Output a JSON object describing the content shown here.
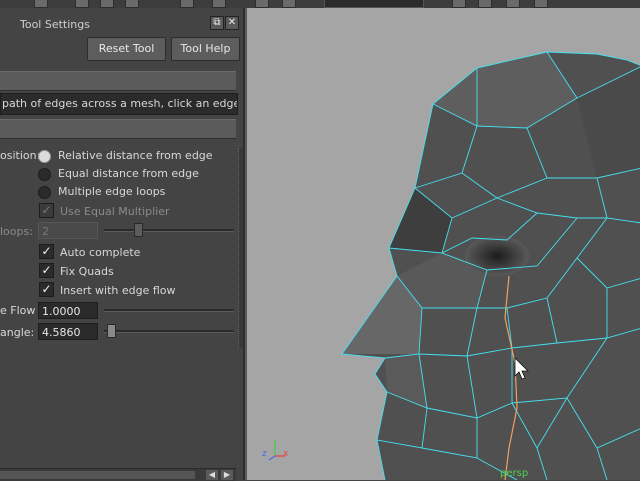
{
  "panel": {
    "title": "Tool Settings",
    "float_glyph": "⧉",
    "close_glyph": "✕",
    "buttons": {
      "reset": "Reset Tool",
      "help": "Tool Help"
    },
    "description": "path of edges across a mesh, click an edge and d",
    "insert_position": {
      "label": "osition:",
      "options": [
        {
          "label": "Relative distance from edge",
          "selected": true
        },
        {
          "label": "Equal distance from edge",
          "selected": false
        },
        {
          "label": "Multiple edge loops",
          "selected": false
        }
      ]
    },
    "use_equal_multiplier": {
      "label": "Use Equal Multiplier",
      "checked": true,
      "enabled": false
    },
    "number_of_loops": {
      "label": "loops:",
      "value": "2",
      "enabled": false
    },
    "auto_complete": {
      "label": "Auto complete",
      "checked": true
    },
    "fix_quads": {
      "label": "Fix Quads",
      "checked": true
    },
    "insert_with_edge_flow": {
      "label": "Insert with edge flow",
      "checked": true
    },
    "adjust_edge_flow": {
      "label": "e Flow",
      "value": "1.0000"
    },
    "smoothing_angle": {
      "label": "angle:",
      "value": "4.5860"
    }
  },
  "viewport": {
    "camera_label": "persp",
    "axis_x": "x",
    "axis_z": "z",
    "wire_color": "#44e0f0",
    "highlight_edge_color": "#f0a060",
    "background_color": "#a5a5a5"
  },
  "icons": [
    "float-window-icon",
    "close-icon",
    "cursor-arrow-icon",
    "axis-gizmo-icon"
  ]
}
